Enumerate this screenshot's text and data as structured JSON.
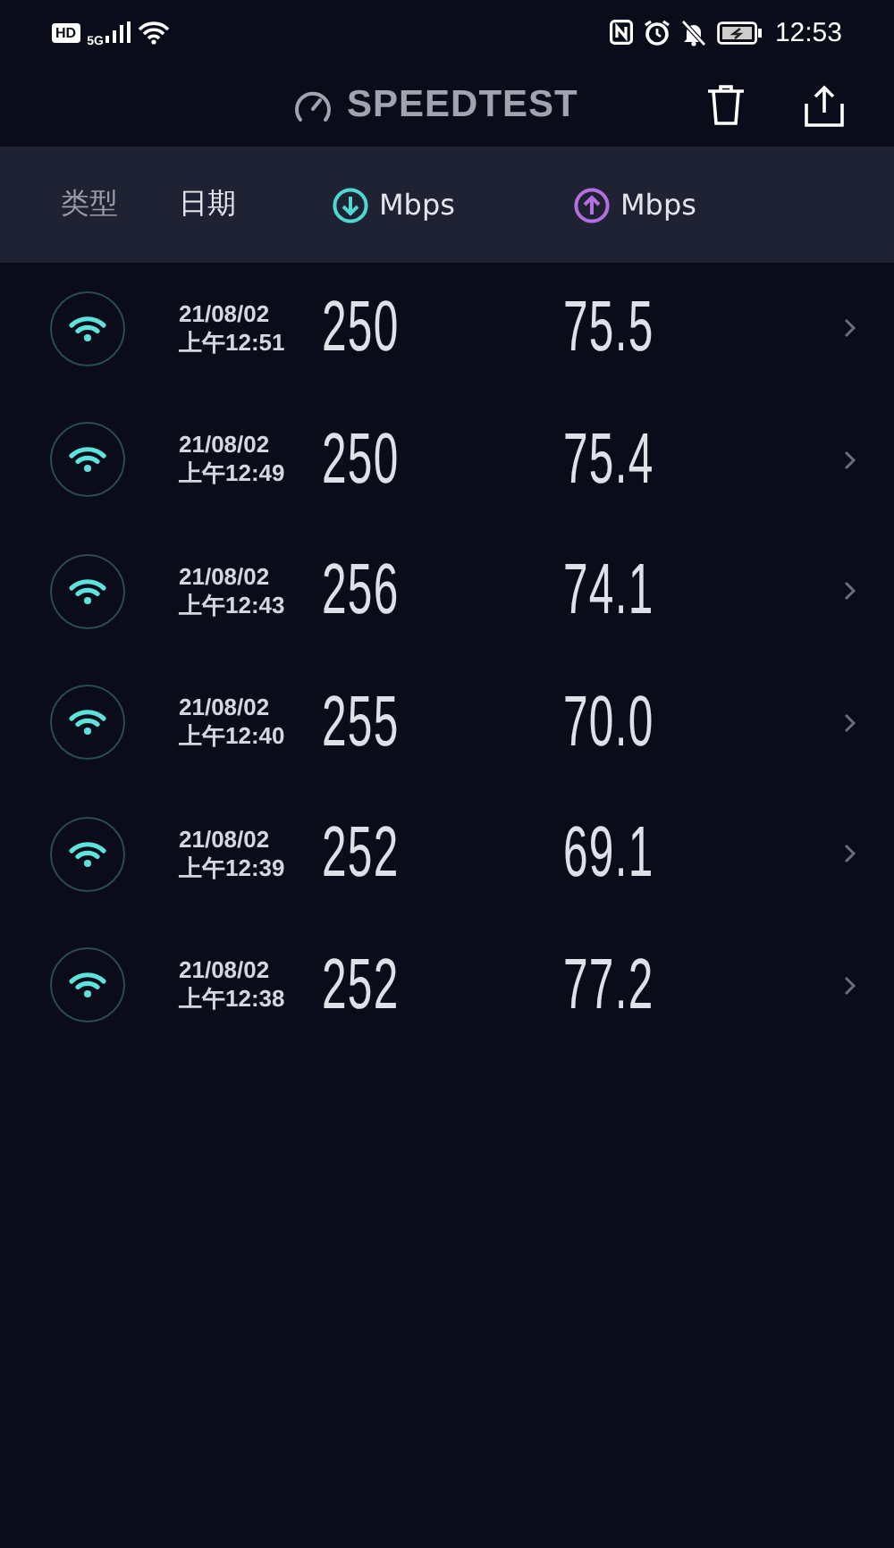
{
  "status_bar": {
    "badges": [
      "HD",
      "5G"
    ],
    "time": "12:53"
  },
  "header": {
    "title": "SPEEDTEST"
  },
  "columns": [
    {
      "kind": "text",
      "label": "类型"
    },
    {
      "kind": "text",
      "label": "日期"
    },
    {
      "kind": "download",
      "label": "Mbps"
    },
    {
      "kind": "upload",
      "label": "Mbps"
    }
  ],
  "rows": [
    {
      "date": "21/08/02",
      "time": "上午12:51",
      "download": "250",
      "upload": "75.5"
    },
    {
      "date": "21/08/02",
      "time": "上午12:49",
      "download": "250",
      "upload": "75.4"
    },
    {
      "date": "21/08/02",
      "time": "上午12:43",
      "download": "256",
      "upload": "74.1"
    },
    {
      "date": "21/08/02",
      "time": "上午12:40",
      "download": "255",
      "upload": "70.0"
    },
    {
      "date": "21/08/02",
      "time": "上午12:39",
      "download": "252",
      "upload": "69.1"
    },
    {
      "date": "21/08/02",
      "time": "上午12:38",
      "download": "252",
      "upload": "77.2"
    }
  ]
}
